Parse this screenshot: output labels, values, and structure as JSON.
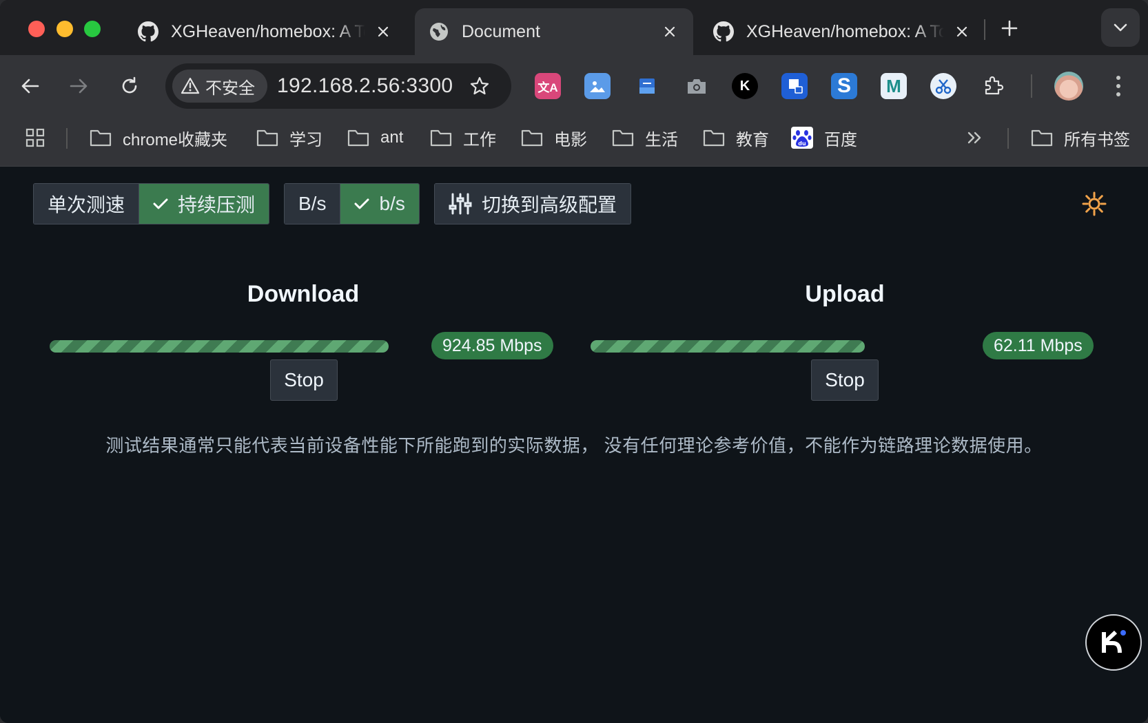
{
  "tabs": [
    {
      "title": "XGHeaven/homebox: A Toolbox for Home Local Networks",
      "icon": "github-icon",
      "active": false
    },
    {
      "title": "Document",
      "icon": "globe-icon",
      "active": true
    },
    {
      "title": "XGHeaven/homebox: A Toolbox for Home Local Networks",
      "icon": "github-icon",
      "active": false
    }
  ],
  "toolbar": {
    "security_label": "不安全",
    "url": "192.168.2.56:3300"
  },
  "bookmarks": {
    "items": [
      "chrome收藏夹",
      "学习",
      "ant",
      "工作",
      "电影",
      "生活",
      "教育",
      "百度"
    ],
    "all_label": "所有书签"
  },
  "controls": {
    "mode_single": "单次测速",
    "mode_continuous": "持续压测",
    "unit_bytes": "B/s",
    "unit_bits": "b/s",
    "advanced": "切换到高级配置"
  },
  "download": {
    "title": "Download",
    "speed": "924.85 Mbps",
    "progress": 1.0,
    "stop_label": "Stop"
  },
  "upload": {
    "title": "Upload",
    "speed": "62.11 Mbps",
    "progress": 1.0,
    "stop_label": "Stop"
  },
  "note": "测试结果通常只能代表当前设备性能下所能跑到的实际数据， 没有任何理论参考价值，不能作为链路理论数据使用。",
  "colors": {
    "accent_green": "#3b7b4f",
    "badge_green": "#2f7a45",
    "page_bg": "#0f1419"
  }
}
